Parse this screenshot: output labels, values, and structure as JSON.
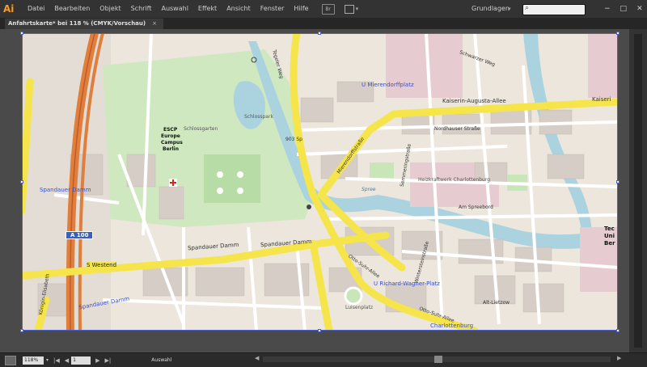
{
  "app": {
    "logo": "Ai"
  },
  "menu": [
    "Datei",
    "Bearbeiten",
    "Objekt",
    "Schrift",
    "Auswahl",
    "Effekt",
    "Ansicht",
    "Fenster",
    "Hilfe"
  ],
  "toolbar": {
    "bridge_label": "Br",
    "arrange_icon": "arrange-documents-icon"
  },
  "workspace": {
    "label": "Grundlagen"
  },
  "search": {
    "placeholder": ""
  },
  "window_controls": {
    "minimize": "−",
    "restore": "□",
    "close": "✕"
  },
  "document_tab": {
    "title": "Anfahrtskarte* bei 118 % (CMYK/Vorschau)",
    "close": "×"
  },
  "map": {
    "labels": {
      "u_mierendorff": "U Mierendorffplatz",
      "kaiserin_augusta": "Kaiserin-Augusta-Allee",
      "kaiserin_short": "Kaiseri",
      "schwarzer_weg": "Schwarzer Weg",
      "tegeler_weg": "Tegeler Weg",
      "escp1": "ESCP",
      "escp2": "Europe",
      "escp3": "Campus",
      "escp4": "Berlin",
      "schlossgarten": "Schlossgarten",
      "schlosspark": "Schlosspark",
      "spandauer_damm_left": "Spandauer Damm",
      "spandauer_damm_main": "Spandauer Damm",
      "spandauer_damm_main2": "Spandauer Damm",
      "a100": "A 100",
      "s_westend": "S Westend",
      "spandauer_damm_bottom": "Spandauer Damm",
      "mierendorffstrasse": "Mierendorffstraße",
      "semmeringstrasse": "Semmeringstraße",
      "northauser": "Nordhauser Straße",
      "am_spreebord": "Am Spreebord",
      "otto_suhr": "Otto-Suhr-Allee",
      "otto_suhr2": "Otto-Suhr-Allee",
      "u_richard_wagner": "U Richard-Wagner-Platz",
      "charlottenburg": "Charlottenburg",
      "tec": "Tec",
      "uni": "Uni",
      "ber": "Ber",
      "heizkraftwerk": "Heizkraftwerk Charlottenburg",
      "konigin": "Königin-Elisabeth",
      "luisenplatz": "Luisenplatz",
      "wintersteinstr": "Wintersteinstraße",
      "alt_lietzow": "Alt-Lietzow",
      "road_903": "903 Sp",
      "spree": "Spree"
    }
  },
  "statusbar": {
    "zoom": "118%",
    "page": "1",
    "tool": "Auswahl"
  },
  "colors": {
    "accent": "#f29a2e",
    "selection": "#4b5fd1",
    "major_road": "#f5e54a",
    "motorway": "#e07f3c",
    "water": "#aad3df",
    "park": "#c8e6b8",
    "building": "#d9d0c9"
  }
}
